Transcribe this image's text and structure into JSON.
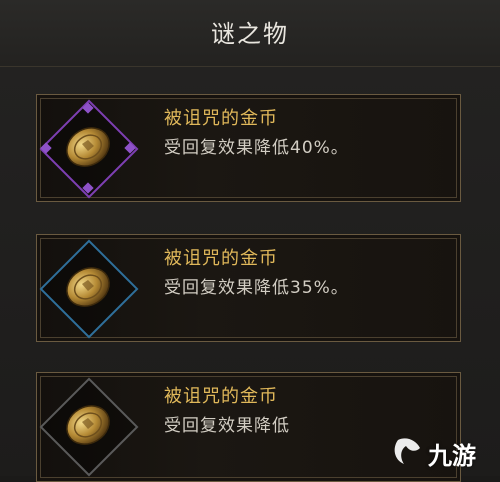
{
  "header": {
    "title": "谜之物"
  },
  "items": [
    {
      "name": "被诅咒的金币",
      "description": "受回复效果降低40%。",
      "frame_color": "#7d3fb2"
    },
    {
      "name": "被诅咒的金币",
      "description": "受回复效果降低35%。",
      "frame_color": "#2f6f9a"
    },
    {
      "name": "被诅咒的金币",
      "description": "受回复效果降低",
      "frame_color": "#5a5a5a"
    }
  ],
  "watermark": {
    "text": "九游"
  },
  "colors": {
    "item_name": "#e0b85a",
    "description": "#d2cdc3",
    "title": "#e9e6df"
  }
}
